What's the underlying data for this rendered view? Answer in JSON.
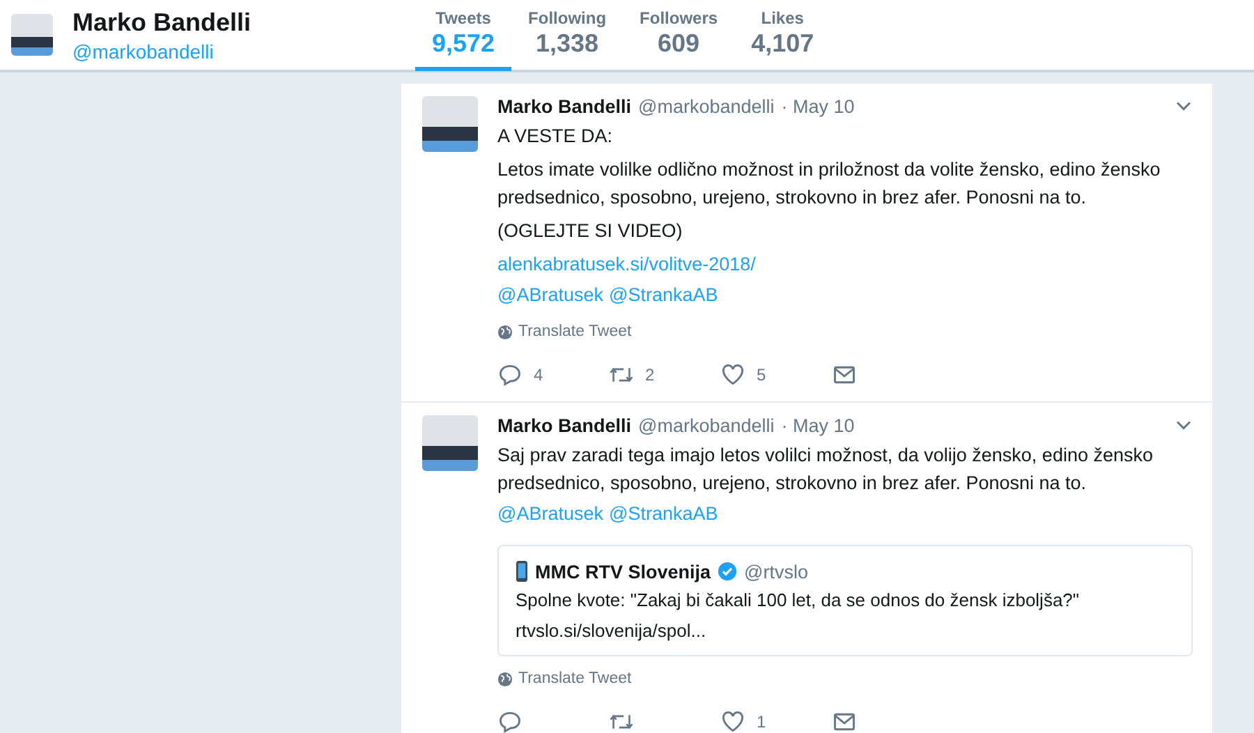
{
  "profile": {
    "name": "Marko Bandelli",
    "handle": "@markobandelli"
  },
  "stats": [
    {
      "label": "Tweets",
      "value": "9,572",
      "selected": true
    },
    {
      "label": "Following",
      "value": "1,338",
      "selected": false
    },
    {
      "label": "Followers",
      "value": "609",
      "selected": false
    },
    {
      "label": "Likes",
      "value": "4,107",
      "selected": false
    }
  ],
  "tweets": [
    {
      "name": "Marko Bandelli",
      "handle": "@markobandelli",
      "date": "· May 10",
      "body": [
        {
          "kind": "text",
          "text": "A VESTE DA:"
        },
        {
          "kind": "text",
          "text": "Letos imate  volilke odlično možnost in priložnost da volite žensko, edino žensko predsednico, sposobno, urejeno, strokovno in brez afer. Ponosni na to."
        },
        {
          "kind": "text",
          "text": "(OGLEJTE SI VIDEO)"
        },
        {
          "kind": "link",
          "text": "alenkabratusek.si/volitve-2018/"
        },
        {
          "kind": "mentions",
          "items": [
            "@ABratusek",
            "@StrankaAB"
          ]
        }
      ],
      "translate": "Translate Tweet",
      "actions": [
        {
          "kind": "reply",
          "count": "4"
        },
        {
          "kind": "retweet",
          "count": "2"
        },
        {
          "kind": "like",
          "count": "5"
        },
        {
          "kind": "message"
        }
      ]
    },
    {
      "name": "Marko Bandelli",
      "handle": "@markobandelli",
      "date": "· May 10",
      "body": [
        {
          "kind": "text",
          "text": "Saj prav zaradi tega imajo letos volilci možnost, da volijo žensko, edino žensko predsednico, sposobno, urejeno, strokovno in brez afer. Ponosni na to."
        },
        {
          "kind": "mentions",
          "items": [
            "@ABratusek",
            "@StrankaAB"
          ]
        }
      ],
      "quote": {
        "name": "MMC RTV Slovenija",
        "verified": true,
        "handle": "@rtvslo",
        "text": "Spolne kvote: \"Zakaj bi čakali 100 let, da se odnos do žensk izboljša?\"",
        "link": "rtvslo.si/slovenija/spol..."
      },
      "translate": "Translate Tweet",
      "actions": [
        {
          "kind": "reply"
        },
        {
          "kind": "retweet"
        },
        {
          "kind": "like",
          "count": "1"
        },
        {
          "kind": "message"
        }
      ]
    }
  ]
}
